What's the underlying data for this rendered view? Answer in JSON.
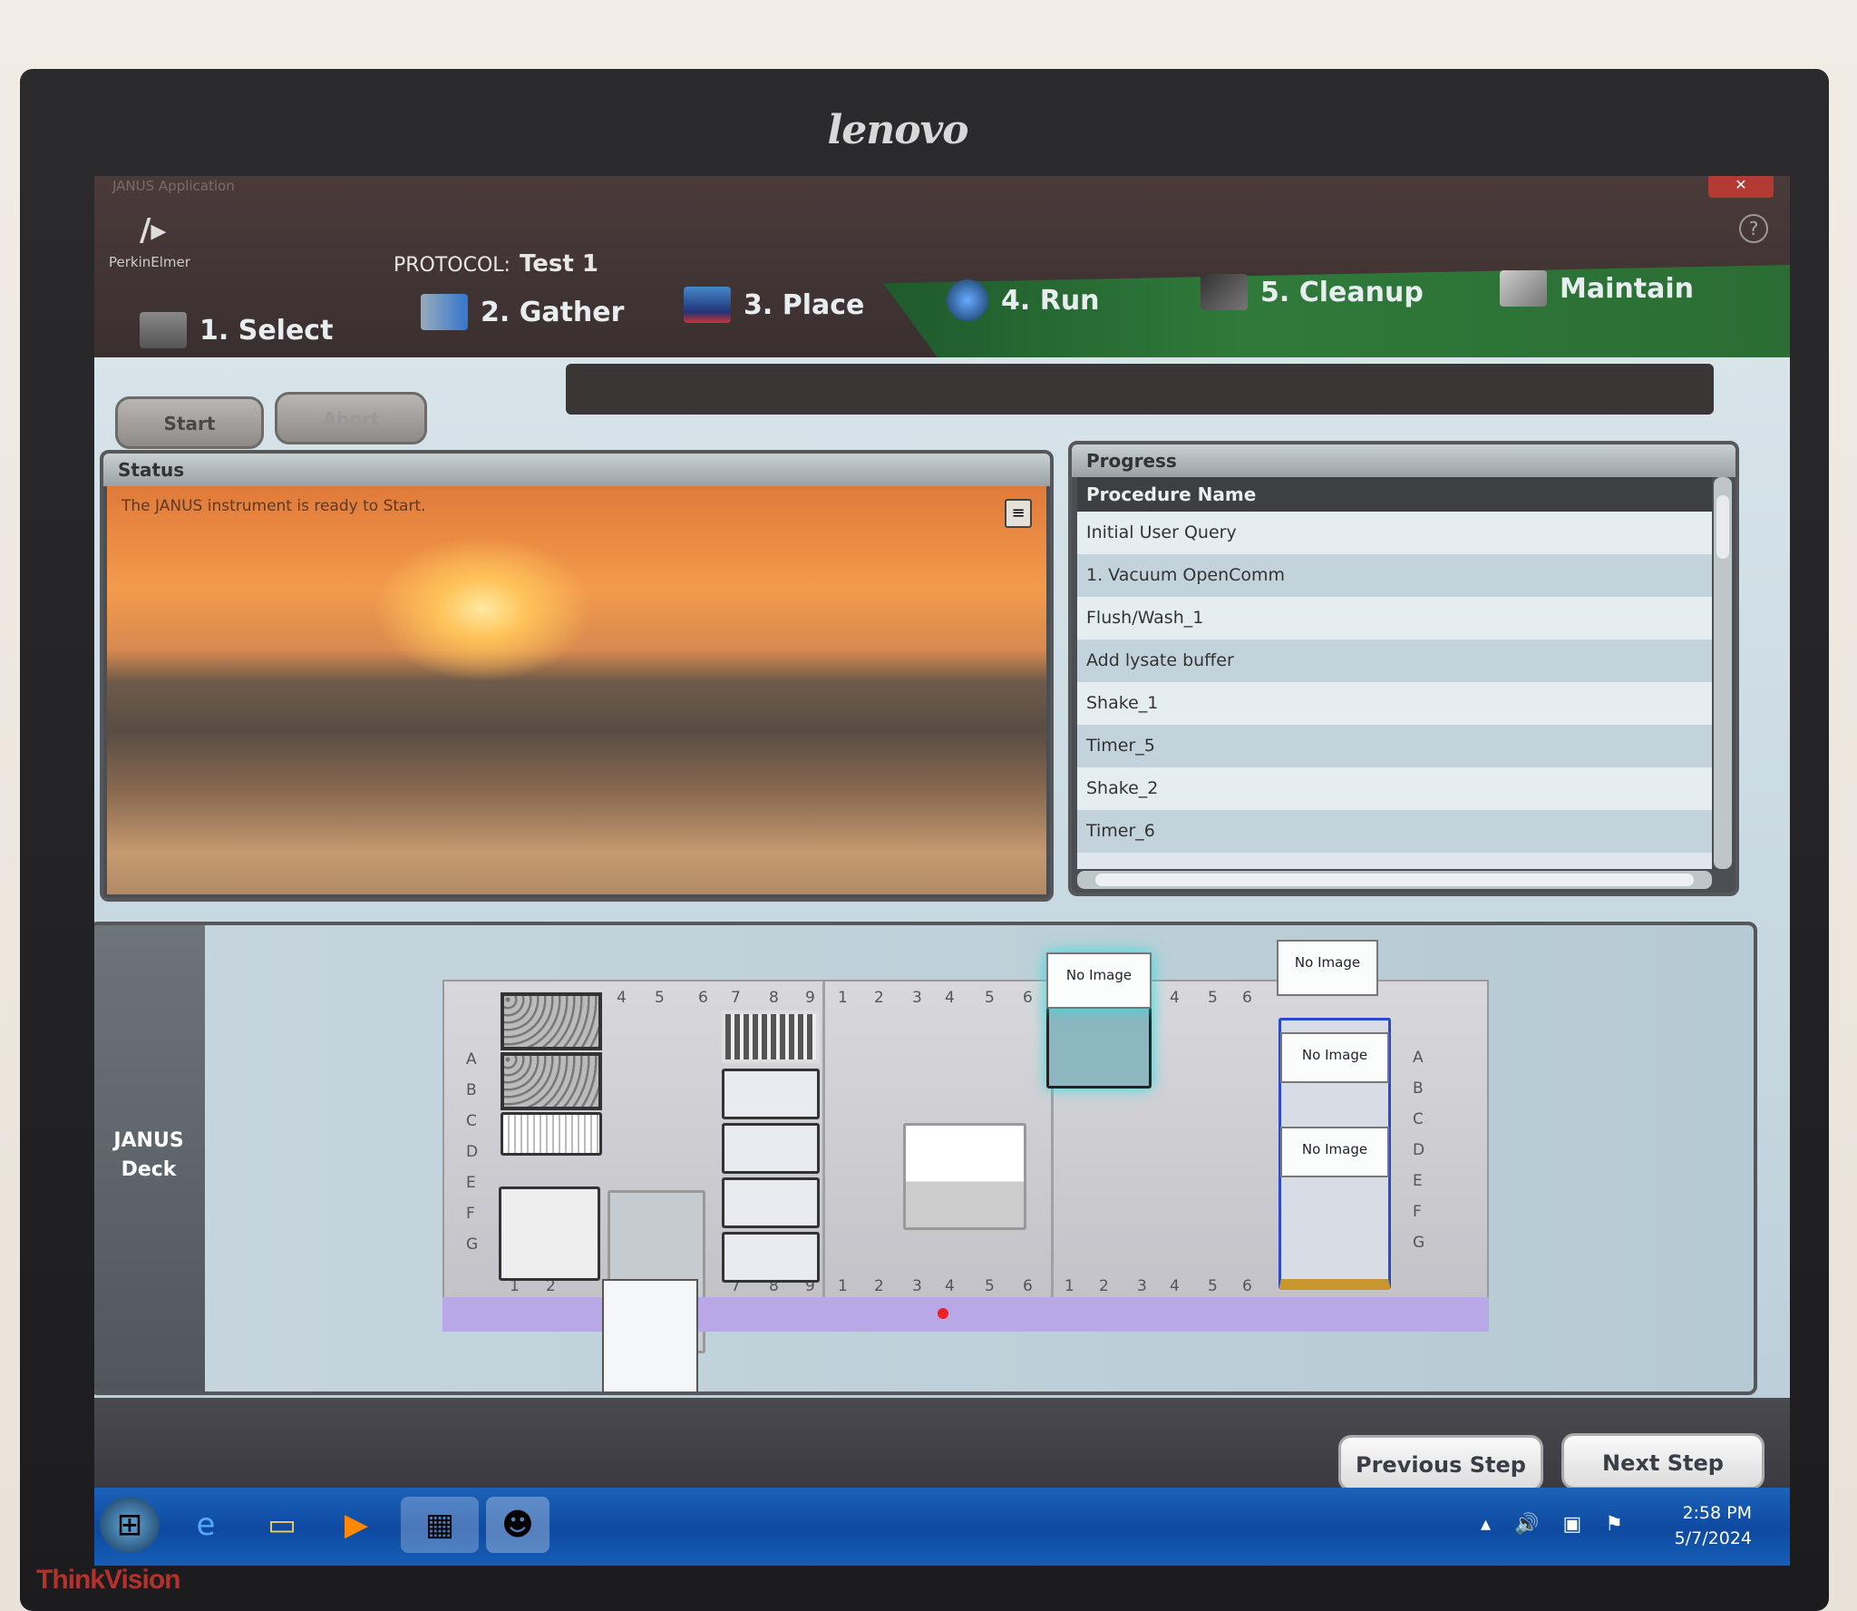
{
  "monitor": {
    "brand": "lenovo",
    "model": "ThinkVision"
  },
  "window": {
    "title": "JANUS Application",
    "close": "✕",
    "help": "?"
  },
  "header": {
    "company": "PerkinElmer",
    "protocol_label": "PROTOCOL:",
    "protocol_name": "Test 1",
    "tabs": [
      {
        "label": "1. Select",
        "icon": "select-icon"
      },
      {
        "label": "2. Gather",
        "icon": "tube-plate-icon"
      },
      {
        "label": "3. Place",
        "icon": "plate-icon"
      },
      {
        "label": "4. Run",
        "icon": "play-icon"
      },
      {
        "label": "5. Cleanup",
        "icon": "broom-icon"
      },
      {
        "label": "Maintain",
        "icon": "wrench-icon"
      }
    ],
    "active_tab": "4. Run"
  },
  "controls": {
    "start": "Start",
    "abort": "Abort"
  },
  "status": {
    "title": "Status",
    "message": "The JANUS instrument is ready to Start."
  },
  "progress": {
    "title": "Progress",
    "column": "Procedure Name",
    "rows": [
      "Initial User Query",
      "1. Vacuum OpenComm",
      "Flush/Wash_1",
      "Add lysate buffer",
      "Shake_1",
      "Timer_5",
      "Shake_2",
      "Timer_6"
    ]
  },
  "deck": {
    "label_line1": "JANUS",
    "label_line2": "Deck",
    "rows": [
      "A",
      "B",
      "C",
      "D",
      "E",
      "F",
      "G"
    ],
    "sec1_top": [
      "4",
      "5",
      "6",
      "7",
      "8",
      "9"
    ],
    "sec1_bottom": [
      "1",
      "2",
      "7",
      "8",
      "9"
    ],
    "sec2_cols": [
      "1",
      "2",
      "3",
      "4",
      "5",
      "6"
    ],
    "sec3_top": [
      "4",
      "5",
      "6"
    ],
    "sec3_bottom": [
      "1",
      "2",
      "3",
      "4",
      "5",
      "6"
    ],
    "no_image": "No Image"
  },
  "nav": {
    "previous": "Previous Step",
    "next": "Next Step"
  },
  "taskbar": {
    "time": "2:58 PM",
    "date": "5/7/2024"
  },
  "colors": {
    "active_tab": "#2f7a3a",
    "header": "#4a3b3a",
    "taskbar": "#0e4aa2",
    "deck_rail": "#b8a8e8"
  }
}
